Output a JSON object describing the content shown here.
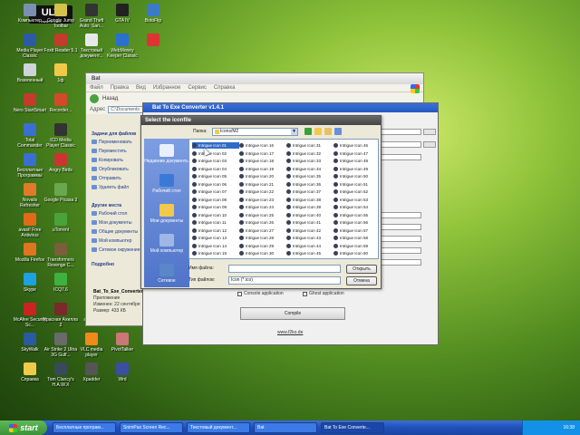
{
  "watermark": {
    "text": "ULT",
    "sub": "www.ult.com"
  },
  "desktop_icons": [
    {
      "label": "Компьютер",
      "color": "#7b90b0",
      "col": 0,
      "row": 0
    },
    {
      "label": "Google Jump Toolbar",
      "color": "#d6c24a",
      "col": 1,
      "row": 0
    },
    {
      "label": "Grand Theft Auto: San...",
      "color": "#333",
      "col": 2,
      "row": 0
    },
    {
      "label": "GTA IV",
      "color": "#222",
      "col": 3,
      "row": 0
    },
    {
      "label": "BotoFlip",
      "color": "#3b7ac9",
      "col": 4,
      "row": 0
    },
    {
      "label": "Media Player Classic",
      "color": "#2d5aa7",
      "col": 0,
      "row": 1
    },
    {
      "label": "Foxit Reader 5.1",
      "color": "#c23b2b",
      "col": 1,
      "row": 1
    },
    {
      "label": "Текстовый документ...",
      "color": "#e8e8e8",
      "col": 2,
      "row": 1
    },
    {
      "label": "WebMoney Keeper Classic",
      "color": "#2b6fcf",
      "col": 3,
      "row": 1
    },
    {
      "label": "",
      "color": "#d33",
      "col": 4,
      "row": 1
    },
    {
      "label": "Возиленный",
      "color": "#cfd3da",
      "col": 0,
      "row": 2
    },
    {
      "label": "1ф",
      "color": "#f1c94a",
      "col": 1,
      "row": 2
    },
    {
      "label": "Nero StartSmart",
      "color": "#c23b2b",
      "col": 0,
      "row": 3
    },
    {
      "label": "Recorder...",
      "color": "#d24a2a",
      "col": 1,
      "row": 3
    },
    {
      "label": "Total Commander",
      "color": "#3a6fd0",
      "col": 0,
      "row": 4
    },
    {
      "label": "ICD Media Player Classic",
      "color": "#333",
      "col": 1,
      "row": 4
    },
    {
      "label": "Бесплатные Программы",
      "color": "#3a6fd0",
      "col": 0,
      "row": 5
    },
    {
      "label": "Angry Birds",
      "color": "#c33",
      "col": 1,
      "row": 5
    },
    {
      "label": "Novalis Refresher",
      "color": "#e07a2a",
      "col": 0,
      "row": 6
    },
    {
      "label": "Google Picasa 3",
      "color": "#6aa84f",
      "col": 1,
      "row": 6
    },
    {
      "label": "avast! Free Antivirus",
      "color": "#e06a1a",
      "col": 0,
      "row": 7
    },
    {
      "label": "uTorrent",
      "color": "#4aa33a",
      "col": 1,
      "row": 7
    },
    {
      "label": "Mozilla Firefox",
      "color": "#e0751f",
      "col": 0,
      "row": 8
    },
    {
      "label": "Transformers Revenge C...",
      "color": "#7a5f3a",
      "col": 1,
      "row": 8
    },
    {
      "label": "Skype",
      "color": "#1fa0e0",
      "col": 0,
      "row": 9
    },
    {
      "label": "ICQ7.6",
      "color": "#3fb13f",
      "col": 1,
      "row": 9
    },
    {
      "label": "McAfee Security Sc...",
      "color": "#c22",
      "col": 0,
      "row": 10
    },
    {
      "label": "Красная Ахилла 2",
      "color": "#7a2a2a",
      "col": 1,
      "row": 10
    },
    {
      "label": "aborder",
      "color": "#444",
      "col": 2,
      "row": 10
    },
    {
      "label": "SpeedFan",
      "color": "#2a6a9a",
      "col": 3,
      "row": 10
    },
    {
      "label": "SkyWalk",
      "color": "#2a5aa0",
      "col": 0,
      "row": 11
    },
    {
      "label": "Air Strike 2 Ultra 3G Gulf...",
      "color": "#6a6a6a",
      "col": 1,
      "row": 11
    },
    {
      "label": "VLC media player",
      "color": "#f08a1a",
      "col": 2,
      "row": 11
    },
    {
      "label": "PivotTalker",
      "color": "#c77",
      "col": 3,
      "row": 11
    },
    {
      "label": "Справка",
      "color": "#f1c94a",
      "col": 0,
      "row": 12
    },
    {
      "label": "Tom Clancy's H.A.W.X",
      "color": "#3a4a5a",
      "col": 1,
      "row": 12
    },
    {
      "label": "Xpadder",
      "color": "#555",
      "col": 2,
      "row": 12
    },
    {
      "label": "Wrd",
      "color": "#3a4fa0",
      "col": 3,
      "row": 12
    }
  ],
  "explorer": {
    "title": "Bat",
    "menu": [
      "Файл",
      "Правка",
      "Вид",
      "Избранное",
      "Сервис",
      "Справка"
    ],
    "back_label": "Назад",
    "address_label": "Адрес",
    "address_value": "C:\\Documents",
    "tasks_header": "Задачи для файлов",
    "tasks": [
      "Переименовать",
      "Переместить",
      "Копировать",
      "Опубликовать",
      "Отправить",
      "Удалить файл"
    ],
    "other_header": "Другие места",
    "other": [
      "Рабочий стол",
      "Мои документы",
      "Общие документы",
      "Мой компьютер",
      "Сетевое окружение"
    ],
    "details_header": "Подробно",
    "details_name": "Bat_To_Exe_Converter",
    "details_type": "Приложение",
    "details_date": "Изменен: 22 сентября",
    "details_size": "Размер: 433 КБ"
  },
  "batwin": {
    "title": "Bat To Exe Converter v1.4.1",
    "console_label": "Console application",
    "ghost_label": "Ghost application",
    "compile_label": "Compile",
    "link": "www.f2ko.de"
  },
  "dialog": {
    "title": "Select the iconfile",
    "lookin_label": "Папка:",
    "lookin_value": "Icons/M2",
    "places": [
      "Недавние документы",
      "Рабочий стол",
      "Мои документы",
      "Мой компьютер",
      "Сетевое"
    ],
    "files": [
      "Intrigue Icon 01",
      "Intrigue Icon 02",
      "Intrigue Icon 03",
      "Intrigue Icon 04",
      "Intrigue Icon 05",
      "Intrigue Icon 06",
      "Intrigue Icon 07",
      "Intrigue Icon 08",
      "Intrigue Icon 09",
      "Intrigue Icon 10",
      "Intrigue Icon 11",
      "Intrigue Icon 12",
      "Intrigue Icon 13",
      "Intrigue Icon 14",
      "Intrigue Icon 15",
      "Intrigue Icon 16",
      "Intrigue Icon 17",
      "Intrigue Icon 18",
      "Intrigue Icon 19",
      "Intrigue Icon 20",
      "Intrigue Icon 21",
      "Intrigue Icon 22",
      "Intrigue Icon 23",
      "Intrigue Icon 24",
      "Intrigue Icon 25",
      "Intrigue Icon 26",
      "Intrigue Icon 27",
      "Intrigue Icon 28",
      "Intrigue Icon 29",
      "Intrigue Icon 30",
      "Intrigue Icon 31",
      "Intrigue Icon 32",
      "Intrigue Icon 33",
      "Intrigue Icon 34",
      "Intrigue Icon 35",
      "Intrigue Icon 36",
      "Intrigue Icon 37",
      "Intrigue Icon 38",
      "Intrigue Icon 39",
      "Intrigue Icon 40",
      "Intrigue Icon 41",
      "Intrigue Icon 42",
      "Intrigue Icon 43",
      "Intrigue Icon 44",
      "Intrigue Icon 45",
      "Intrigue Icon 46",
      "Intrigue Icon 47",
      "Intrigue Icon 48",
      "Intrigue Icon 49",
      "Intrigue Icon 50",
      "Intrigue Icon 51",
      "Intrigue Icon 52",
      "Intrigue Icon 53",
      "Intrigue Icon 54",
      "Intrigue Icon 55",
      "Intrigue Icon 56",
      "Intrigue Icon 57",
      "Intrigue Icon 58",
      "Intrigue Icon 59",
      "Intrigue Icon 60"
    ],
    "selected_file": "Intrigue Icon 01",
    "filename_label": "Имя файла:",
    "filename_value": "",
    "filetype_label": "Тип файлов:",
    "filetype_value": "Icon (*.ico)",
    "open_label": "Открыть",
    "cancel_label": "Отмена"
  },
  "taskbar": {
    "start_label": "start",
    "items": [
      "Бесплатные програм...",
      "SnimPax Screen Rec...",
      "Текстовый документ...",
      "Bat",
      "Bat To Exe Converte..."
    ],
    "active_index": 4,
    "clock": "16:38"
  }
}
